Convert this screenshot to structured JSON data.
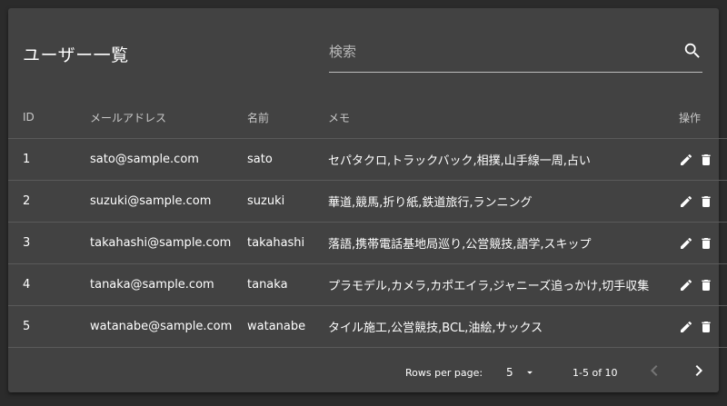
{
  "header": {
    "title": "ユーザー一覧",
    "search_placeholder": "検索",
    "search_icon": "search-icon"
  },
  "table": {
    "columns": [
      "ID",
      "メールアドレス",
      "名前",
      "メモ",
      "操作"
    ],
    "rows": [
      {
        "id": "1",
        "email": "sato@sample.com",
        "name": "sato",
        "memo": "セパタクロ,トラックバック,相撲,山手線一周,占い"
      },
      {
        "id": "2",
        "email": "suzuki@sample.com",
        "name": "suzuki",
        "memo": "華道,競馬,折り紙,鉄道旅行,ランニング"
      },
      {
        "id": "3",
        "email": "takahashi@sample.com",
        "name": "takahashi",
        "memo": "落語,携帯電話基地局巡り,公営競技,語学,スキップ"
      },
      {
        "id": "4",
        "email": "tanaka@sample.com",
        "name": "tanaka",
        "memo": "プラモデル,カメラ,カポエイラ,ジャニーズ追っかけ,切手収集"
      },
      {
        "id": "5",
        "email": "watanabe@sample.com",
        "name": "watanabe",
        "memo": "タイル施工,公営競技,BCL,油絵,サックス"
      }
    ],
    "row_action_icons": [
      "edit-icon",
      "delete-icon"
    ]
  },
  "pagination": {
    "rows_per_page_label": "Rows per page:",
    "rows_per_page_value": "5",
    "range_text": "1-5 of 10",
    "prev_disabled": true
  },
  "colors": {
    "background": "#2b2b2b",
    "card": "#424242",
    "text": "#ffffff",
    "muted_text": "#c8c8c8",
    "divider": "#5a5a5a",
    "disabled": "#757575"
  }
}
